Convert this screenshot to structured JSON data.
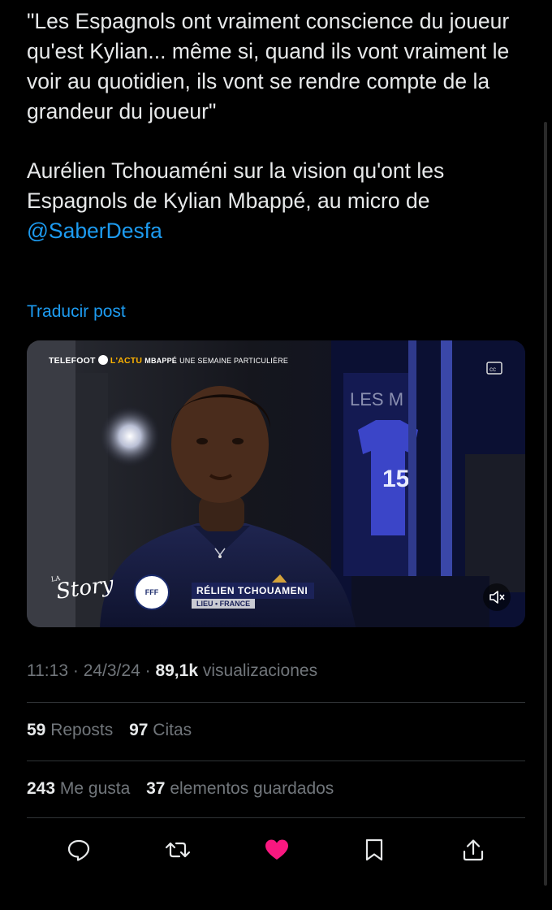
{
  "tweet": {
    "quote": "\"Les Espagnols ont vraiment conscience du joueur qu'est Kylian... même si, quand ils vont vraiment le voir au quotidien, ils vont se rendre compte de la grandeur du joueur\"",
    "body": "Aurélien Tchouaméni sur la vision qu'ont les Espagnols de Kylian Mbappé, au micro de",
    "mention": "@SaberDesfa",
    "translate_label": "Traducir post"
  },
  "video": {
    "brand": "TELEFOOT",
    "brand_actu": "L'ACTU",
    "subtitle_bold": "MBAPPÉ",
    "subtitle": "UNE SEMAINE PARTICULIÈRE",
    "story_la": "LA",
    "story": "Story",
    "fff_badge": "FFF",
    "name_lower_third": "RÉLIEN TCHOUAMENI",
    "place_lower_third": "LIEU • FRANCE",
    "locker_sign": "LES M",
    "jersey_number": "15"
  },
  "meta": {
    "time": "11:13",
    "sep1": "·",
    "date": "24/3/24",
    "sep2": "·",
    "views": "89,1k",
    "views_label": "visualizaciones"
  },
  "stats": {
    "reposts": "59",
    "reposts_label": "Reposts",
    "quotes": "97",
    "quotes_label": "Citas",
    "likes": "243",
    "likes_label": "Me gusta",
    "bookmarks": "37",
    "bookmarks_label": "elementos guardados"
  },
  "icons": {
    "reply": "reply-icon",
    "repost": "repost-icon",
    "like": "heart-icon",
    "bookmark": "bookmark-icon",
    "share": "share-icon"
  },
  "colors": {
    "background": "#000000",
    "text": "#e7e9ea",
    "muted": "#71767b",
    "accent": "#1d9bf0",
    "like": "#f91880"
  }
}
